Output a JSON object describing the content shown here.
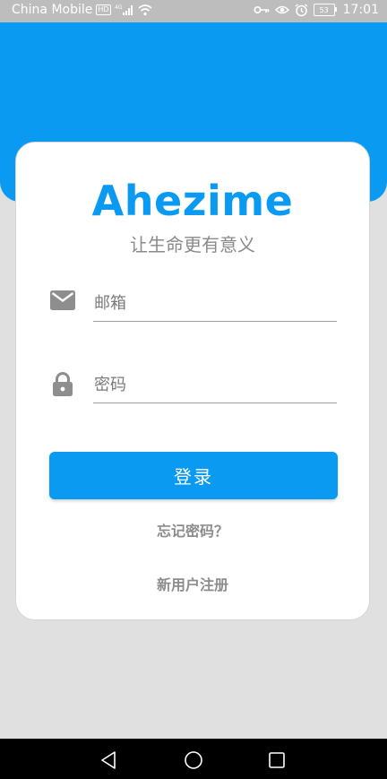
{
  "status_bar": {
    "carrier": "China Mobile",
    "hd_badge": "HD",
    "network": "4G",
    "battery": "53",
    "time": "17:01",
    "icons": [
      "hd-icon",
      "signal-icon",
      "wifi-icon",
      "key-icon",
      "eye-icon",
      "alarm-icon",
      "battery-icon"
    ]
  },
  "colors": {
    "accent": "#0a9af2",
    "muted_text": "#8a8a8a",
    "background": "#e0e0e0"
  },
  "login": {
    "app_name": "Ahezime",
    "tagline": "让生命更有意义",
    "email_placeholder": "邮箱",
    "email_value": "",
    "email_icon": "mail-icon",
    "password_placeholder": "密码",
    "password_value": "",
    "password_icon": "lock-icon",
    "login_label": "登录",
    "forgot_label": "忘记密码？",
    "register_label": "新用户注册"
  },
  "nav_bar": {
    "icons": [
      "back-icon",
      "home-icon",
      "recents-icon"
    ]
  }
}
